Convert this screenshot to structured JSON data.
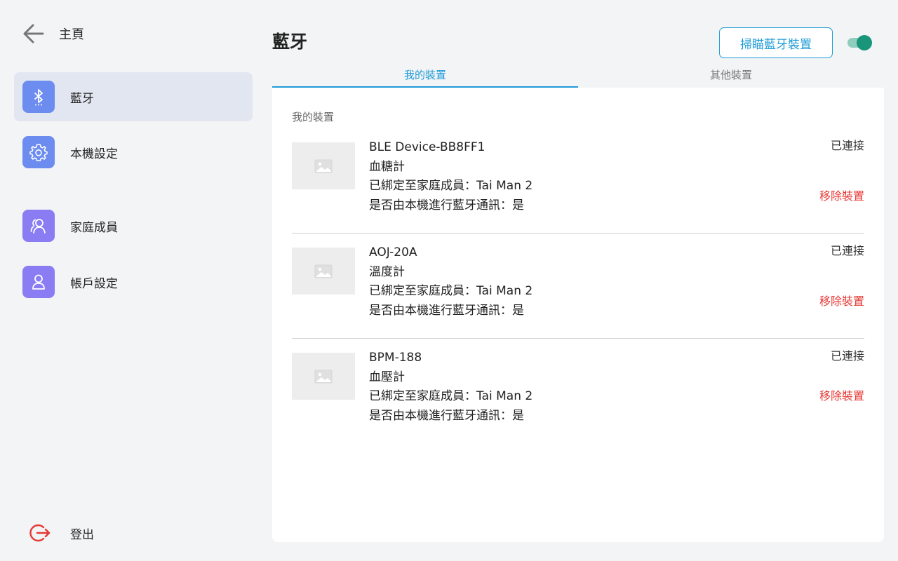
{
  "sidebar": {
    "back_label": "主頁",
    "items": [
      {
        "label": "藍牙",
        "icon": "bluetooth-icon",
        "color": "#6c8cf0",
        "active": true
      },
      {
        "label": "本機設定",
        "icon": "gear-icon",
        "color": "#6c8cf0",
        "active": false
      },
      {
        "label": "家庭成員",
        "icon": "family-members-icon",
        "color": "#8a7cf2",
        "active": false
      },
      {
        "label": "帳戶設定",
        "icon": "user-icon",
        "color": "#8a7cf2",
        "active": false
      }
    ],
    "logout_label": "登出"
  },
  "header": {
    "title": "藍牙",
    "scan_button_label": "掃瞄藍牙裝置",
    "bluetooth_toggle_on": true
  },
  "tabs": [
    {
      "label": "我的裝置",
      "active": true
    },
    {
      "label": "其他裝置",
      "active": false
    }
  ],
  "main": {
    "section_title": "我的裝置",
    "devices": [
      {
        "name": "BLE Device-BB8FF1",
        "type": "血糖計",
        "bound": "已綁定至家庭成員：Tai Man 2",
        "comm": "是否由本機進行藍牙通訊：是",
        "status": "已連接",
        "remove_label": "移除裝置"
      },
      {
        "name": "AOJ-20A",
        "type": "溫度計",
        "bound": "已綁定至家庭成員：Tai Man 2",
        "comm": "是否由本機進行藍牙通訊：是",
        "status": "已連接",
        "remove_label": "移除裝置"
      },
      {
        "name": "BPM-188",
        "type": "血壓計",
        "bound": "已綁定至家庭成員：Tai Man 2",
        "comm": "是否由本機進行藍牙通訊：是",
        "status": "已連接",
        "remove_label": "移除裝置"
      }
    ]
  },
  "colors": {
    "accent": "#1e9bd7",
    "danger": "#e53935",
    "toggle_on": "#19957a"
  }
}
